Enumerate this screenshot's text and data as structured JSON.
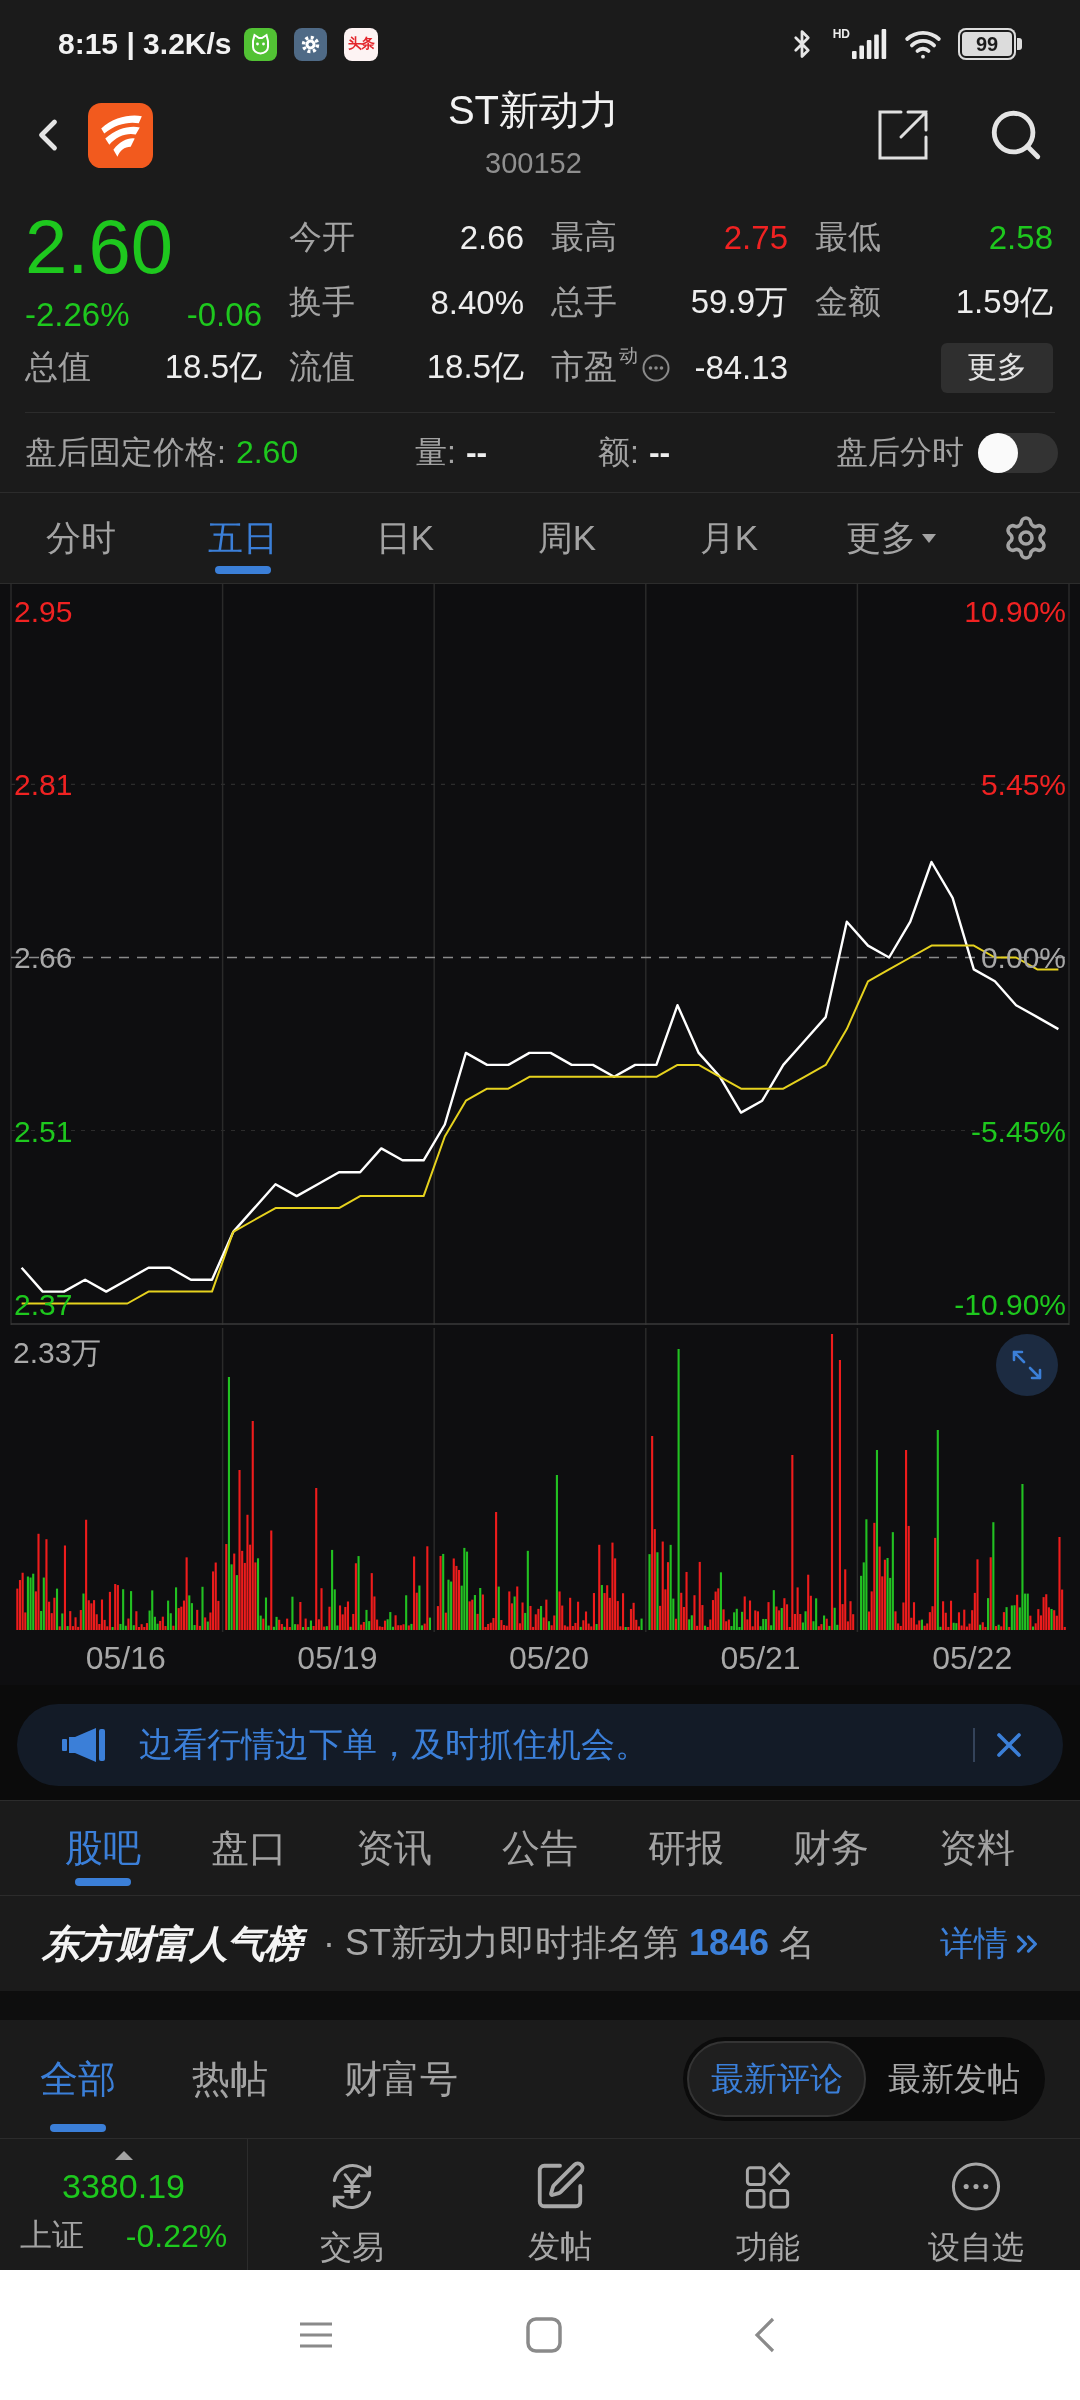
{
  "status_bar": {
    "time_and_speed": "8:15 | 3.2K/s",
    "news_app_badge": "头条",
    "signal_label": "HD",
    "battery": "99"
  },
  "header": {
    "title": "ST新动力",
    "code": "300152"
  },
  "quote": {
    "price": "2.60",
    "change_percent": "-2.26%",
    "change": "-0.06",
    "down": true,
    "stats": [
      {
        "label": "今开",
        "value": "2.66",
        "color": "#eeeeee",
        "kind": "stat"
      },
      {
        "label": "最高",
        "value": "2.75",
        "color": "#f02222",
        "kind": "stat"
      },
      {
        "label": "最低",
        "value": "2.58",
        "color": "#1ec81e",
        "kind": "stat"
      },
      {
        "label": "换手",
        "value": "8.40%",
        "color": "#eeeeee",
        "kind": "stat"
      },
      {
        "label": "总手",
        "value": "59.9万",
        "color": "#eeeeee",
        "kind": "stat"
      },
      {
        "label": "金额",
        "value": "1.59亿",
        "color": "#eeeeee",
        "kind": "stat"
      },
      {
        "label": "总值",
        "value": "18.5亿",
        "color": "#eeeeee",
        "kind": "stat"
      },
      {
        "label": "流值",
        "value": "18.5亿",
        "color": "#eeeeee",
        "kind": "stat"
      },
      {
        "label": "市盈$^{动}$",
        "value": "-84.13",
        "color": "#eeeeee",
        "kind": "stat_info"
      }
    ],
    "more_button": "更多"
  },
  "after_hours": {
    "price_label": "盘后固定价格:",
    "price": "2.60",
    "down": true,
    "volume_label": "量:",
    "volume": "--",
    "amount_label": "额:",
    "amount": "--",
    "chart_toggle": {
      "label": "盘后分时",
      "on": false
    }
  },
  "chart_tabs": [
    {
      "label": "分时",
      "selected": false,
      "kind": "tab"
    },
    {
      "label": "五日",
      "selected": true,
      "kind": "tab"
    },
    {
      "label": "日K",
      "selected": false,
      "kind": "tab"
    },
    {
      "label": "周K",
      "selected": false,
      "kind": "tab"
    },
    {
      "label": "月K",
      "selected": false,
      "kind": "tab"
    },
    {
      "label": "更多",
      "selected": false,
      "kind": "dropdown"
    }
  ],
  "chart": {
    "price": {
      "chart_data": {
        "type": "line",
        "categories": [
          null,
          null,
          null,
          null,
          null,
          null,
          null,
          null,
          null,
          null,
          null,
          null,
          null,
          null,
          null,
          null,
          null,
          null,
          null,
          null,
          null,
          null,
          null,
          null,
          null,
          null,
          null,
          null,
          null,
          null,
          null,
          null,
          null,
          null,
          null,
          null,
          null,
          null,
          null,
          null,
          null,
          null,
          null,
          null,
          null,
          null,
          null,
          null,
          null,
          null
        ],
        "ylim": [
          2.352,
          2.973
        ],
        "yticks": [
          {
            "value": 2.95,
            "label": "2.95"
          },
          {
            "value": 2.805,
            "label": "2.81"
          },
          {
            "value": 2.66,
            "label": "2.66"
          },
          {
            "value": 2.515,
            "label": "2.51"
          },
          {
            "value": 2.37,
            "label": "2.37"
          }
        ],
        "ref_lines": [
          {
            "axis": "y",
            "value": 2.66
          }
        ],
        "series": [
          {
            "color": "#ffffff",
            "values": [
              2.4,
              2.38,
              2.38,
              2.39,
              2.38,
              2.39,
              2.4,
              2.4,
              2.39,
              2.39,
              2.43,
              2.45,
              2.47,
              2.46,
              2.47,
              2.48,
              2.48,
              2.5,
              2.49,
              2.49,
              2.52,
              2.58,
              2.57,
              2.57,
              2.58,
              2.58,
              2.57,
              2.57,
              2.56,
              2.57,
              2.57,
              2.62,
              2.58,
              2.56,
              2.53,
              2.54,
              2.57,
              2.59,
              2.61,
              2.69,
              2.67,
              2.66,
              2.69,
              2.74,
              2.71,
              2.65,
              2.64,
              2.62,
              2.61,
              2.6
            ]
          },
          {
            "color": "#e6d21e",
            "values": [
              2.37,
              2.37,
              2.37,
              2.37,
              2.37,
              2.37,
              2.38,
              2.38,
              2.38,
              2.38,
              2.43,
              2.44,
              2.45,
              2.45,
              2.45,
              2.45,
              2.46,
              2.46,
              2.46,
              2.46,
              2.51,
              2.54,
              2.55,
              2.55,
              2.56,
              2.56,
              2.56,
              2.56,
              2.56,
              2.56,
              2.56,
              2.57,
              2.57,
              2.56,
              2.55,
              2.55,
              2.55,
              2.56,
              2.57,
              2.6,
              2.64,
              2.65,
              2.66,
              2.67,
              2.67,
              2.67,
              2.66,
              2.66,
              2.65,
              2.65
            ]
          }
        ]
      },
      "percent_labels": [
        "10.90%",
        "5.45%",
        "0.00%",
        "-5.45%",
        "-10.90%"
      ]
    },
    "volume": {
      "max_label": "2.33万"
    },
    "dates": [
      "05/16",
      "05/19",
      "05/20",
      "05/21",
      "05/22"
    ]
  },
  "banner": {
    "text": "边看行情边下单，及时抓住机会。"
  },
  "section_tabs": [
    {
      "label": "股吧",
      "selected": true
    },
    {
      "label": "盘口",
      "selected": false
    },
    {
      "label": "资讯",
      "selected": false
    },
    {
      "label": "公告",
      "selected": false
    },
    {
      "label": "研报",
      "selected": false
    },
    {
      "label": "财务",
      "selected": false
    },
    {
      "label": "资料",
      "selected": false
    }
  ],
  "ranking": {
    "brand": "东方财富人气榜",
    "text": "· ST新动力即时排名第 **1846** 名",
    "link": "详情"
  },
  "post_tabs": [
    {
      "label": "全部",
      "selected": true
    },
    {
      "label": "热帖",
      "selected": false
    },
    {
      "label": "财富号",
      "selected": false
    }
  ],
  "sort_options": [
    {
      "label": "最新评论",
      "selected": true
    },
    {
      "label": "最新发帖",
      "selected": false
    }
  ],
  "bottom_nav": {
    "index": {
      "value": "3380.19",
      "name": "上证",
      "change": "-0.22%",
      "down": true
    },
    "items": [
      "交易",
      "发帖",
      "功能",
      "设自选"
    ]
  }
}
